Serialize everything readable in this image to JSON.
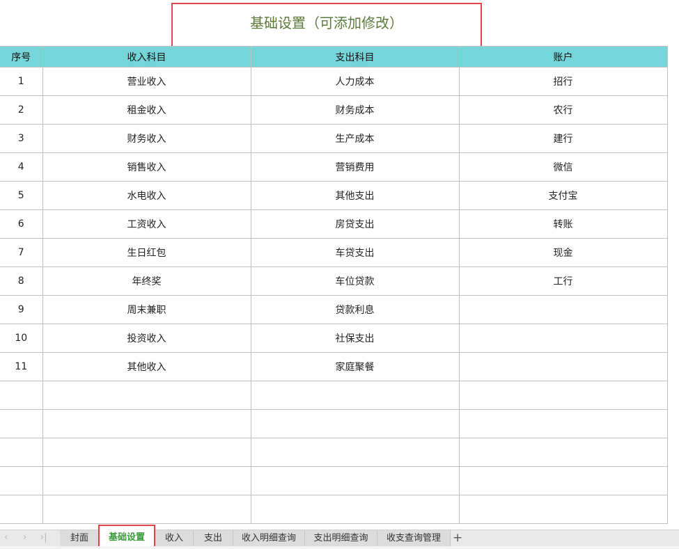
{
  "title": "基础设置（可添加修改）",
  "headers": [
    "序号",
    "收入科目",
    "支出科目",
    "账户"
  ],
  "rows": [
    [
      "1",
      "营业收入",
      "人力成本",
      "招行"
    ],
    [
      "2",
      "租金收入",
      "财务成本",
      "农行"
    ],
    [
      "3",
      "财务收入",
      "生产成本",
      "建行"
    ],
    [
      "4",
      "销售收入",
      "营销费用",
      "微信"
    ],
    [
      "5",
      "水电收入",
      "其他支出",
      "支付宝"
    ],
    [
      "6",
      "工资收入",
      "房贷支出",
      "转账"
    ],
    [
      "7",
      "生日红包",
      "车贷支出",
      "现金"
    ],
    [
      "8",
      "年终奖",
      "车位贷款",
      "工行"
    ],
    [
      "9",
      "周末兼职",
      "贷款利息",
      ""
    ],
    [
      "10",
      "投资收入",
      "社保支出",
      ""
    ],
    [
      "11",
      "其他收入",
      "家庭聚餐",
      ""
    ],
    [
      "",
      "",
      "",
      ""
    ],
    [
      "",
      "",
      "",
      ""
    ],
    [
      "",
      "",
      "",
      ""
    ],
    [
      "",
      "",
      "",
      ""
    ],
    [
      "",
      "",
      "",
      ""
    ]
  ],
  "tabs": [
    "封面",
    "基础设置",
    "收入",
    "支出",
    "收入明细查询",
    "支出明细查询",
    "收支查询管理"
  ],
  "active_tab": "基础设置",
  "nav_icons": [
    "first-sheet-icon",
    "prev-sheet-icon",
    "next-sheet-icon",
    "last-sheet-icon"
  ],
  "add_sheet_icon": "plus-icon",
  "colors": {
    "header_bg": "#76d5d8",
    "title_text": "#5b7a3a",
    "highlight_border": "#e04545",
    "active_tab_text": "#3a9d3a"
  }
}
